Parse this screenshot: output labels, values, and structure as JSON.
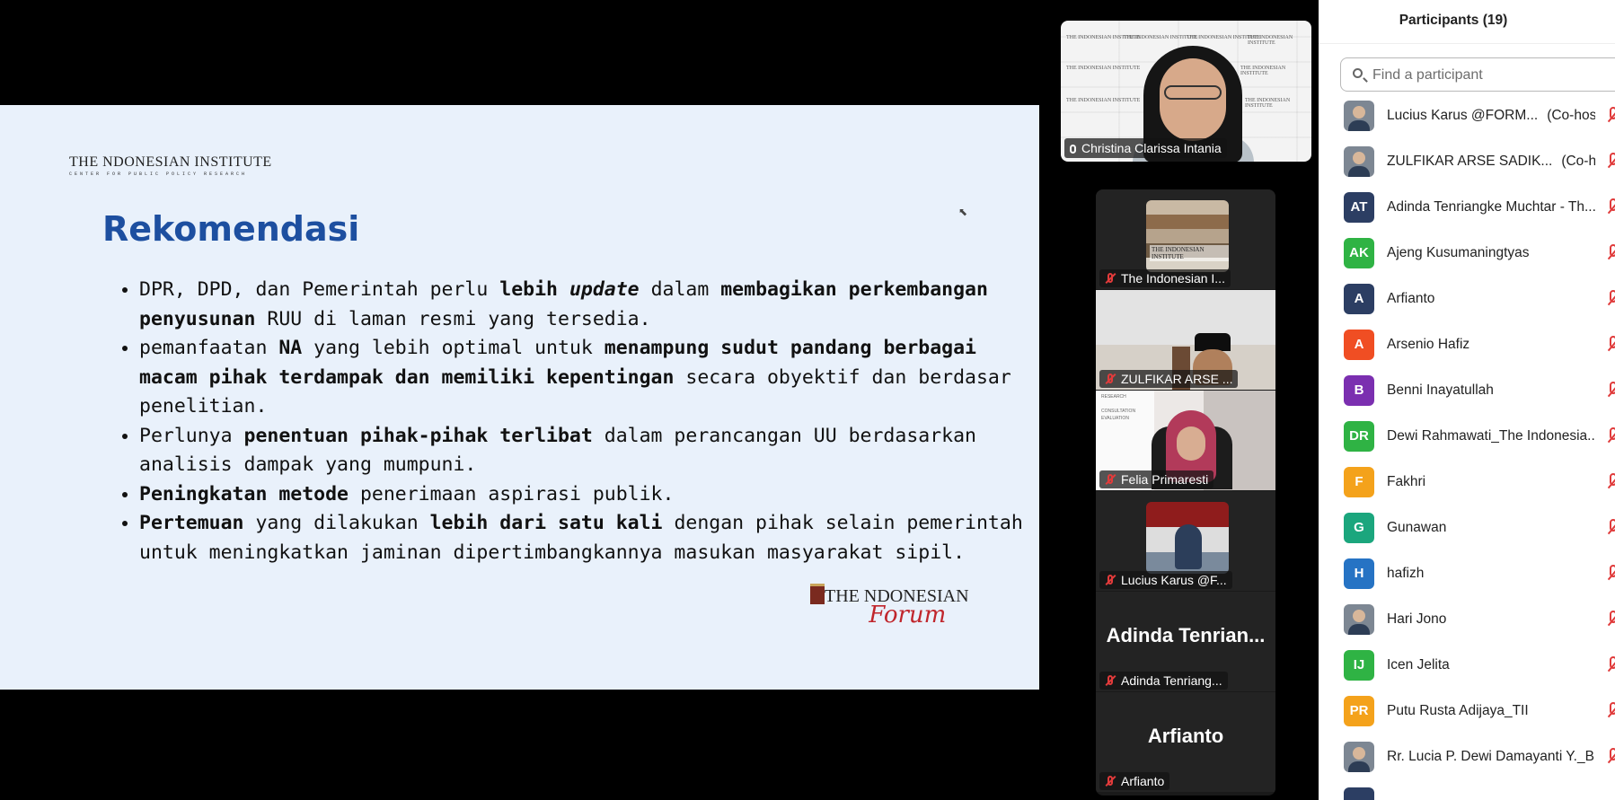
{
  "slide": {
    "logo_top": {
      "main": "THE  NDONESIAN INSTITUTE",
      "sub": "CENTER FOR PUBLIC POLICY RESEARCH"
    },
    "title": "Rekomendasi",
    "bullets": [
      [
        {
          "t": "DPR, DPD, dan Pemerintah perlu "
        },
        {
          "t": "lebih ",
          "b": true
        },
        {
          "t": "update",
          "b": true,
          "i": true
        },
        {
          "t": " dalam "
        },
        {
          "t": "membagikan perkembangan penyusunan",
          "b": true
        },
        {
          "t": " RUU di laman resmi yang tersedia."
        }
      ],
      [
        {
          "t": "pemanfaatan "
        },
        {
          "t": "NA",
          "b": true
        },
        {
          "t": " yang lebih optimal untuk "
        },
        {
          "t": "menampung sudut pandang berbagai macam pihak terdampak dan memiliki kepentingan",
          "b": true
        },
        {
          "t": " secara obyektif dan berdasar penelitian."
        }
      ],
      [
        {
          "t": "Perlunya "
        },
        {
          "t": "penentuan pihak-pihak terlibat",
          "b": true
        },
        {
          "t": " dalam perancangan UU berdasarkan analisis dampak yang mumpuni."
        }
      ],
      [
        {
          "t": "Peningkatan metode",
          "b": true
        },
        {
          "t": " penerimaan aspirasi publik."
        }
      ],
      [
        {
          "t": "Pertemuan",
          "b": true
        },
        {
          "t": " yang dilakukan "
        },
        {
          "t": "lebih dari satu kali",
          "b": true
        },
        {
          "t": " dengan pihak selain pemerintah untuk meningkatkan jaminan dipertimbangkannya masukan masyarakat sipil."
        }
      ]
    ],
    "logo_bottom": {
      "main": "THE  NDONESIAN",
      "script": "Forum"
    }
  },
  "speaker": {
    "name": "Christina Clarissa Intania",
    "backdrop_text": "THE INDONESIAN INSTITUTE"
  },
  "gallery": [
    {
      "name": "The Indonesian I...",
      "kind": "thumb-books",
      "thumb_text": "THE INDONESIAN INSTITUTE"
    },
    {
      "name": "ZULFIKAR ARSE ...",
      "kind": "video-zulfikar"
    },
    {
      "name": "Felia Primaresti",
      "kind": "video-felia",
      "screen_text": [
        "RESEARCH",
        "CONSULTATION",
        "EVALUATION"
      ]
    },
    {
      "name": "Lucius Karus @F...",
      "kind": "thumb-lucius"
    },
    {
      "name": "Adinda Tenriang...",
      "kind": "name",
      "big_name": "Adinda Tenrian..."
    },
    {
      "name": "Arfianto",
      "kind": "name",
      "big_name": "Arfianto"
    }
  ],
  "participants": {
    "title": "Participants (19)",
    "search_placeholder": "Find a participant",
    "list": [
      {
        "initials": "",
        "photo": true,
        "name": "Lucius Karus @FORM...",
        "role": "(Co-host)",
        "muted": true
      },
      {
        "initials": "",
        "photo": true,
        "name": "ZULFIKAR ARSE SADIK...",
        "role": "(Co-host)",
        "muted": true
      },
      {
        "initials": "AT",
        "color": "#2c3e63",
        "name": "Adinda Tenriangke Muchtar - Th...",
        "muted": true
      },
      {
        "initials": "AK",
        "color": "#2fb344",
        "name": "Ajeng Kusumaningtyas",
        "muted": true
      },
      {
        "initials": "A",
        "color": "#2c3e63",
        "name": "Arfianto",
        "muted": true
      },
      {
        "initials": "A",
        "color": "#f04e23",
        "name": "Arsenio Hafiz",
        "muted": true
      },
      {
        "initials": "B",
        "color": "#7b2fb0",
        "name": "Benni Inayatullah",
        "muted": true
      },
      {
        "initials": "DR",
        "color": "#2fb344",
        "name": "Dewi Rahmawati_The Indonesia...",
        "muted": true
      },
      {
        "initials": "F",
        "color": "#f4a21b",
        "name": "Fakhri",
        "muted": true
      },
      {
        "initials": "G",
        "color": "#1ba67d",
        "name": "Gunawan",
        "muted": true
      },
      {
        "initials": "H",
        "color": "#2673c4",
        "name": "hafizh",
        "muted": true
      },
      {
        "initials": "",
        "photo": true,
        "name": "Hari Jono",
        "muted": true
      },
      {
        "initials": "IJ",
        "color": "#2fb344",
        "name": "Icen Jelita",
        "muted": true
      },
      {
        "initials": "PR",
        "color": "#f4a21b",
        "name": "Putu Rusta Adijaya_TII",
        "muted": true
      },
      {
        "initials": "",
        "photo": true,
        "name": "Rr. Lucia P. Dewi Damayanti Y._B...",
        "muted": true
      },
      {
        "initials": "",
        "color": "#2c3e63",
        "name": "",
        "muted": false
      }
    ]
  }
}
